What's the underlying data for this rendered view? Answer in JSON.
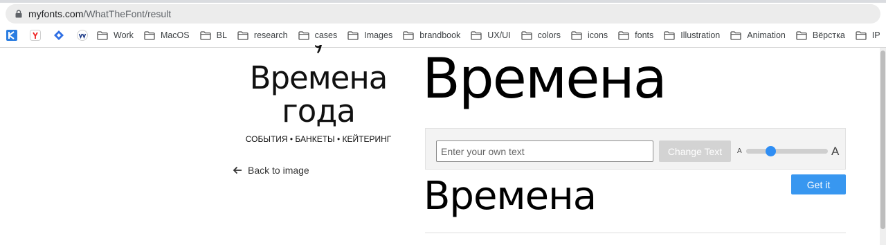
{
  "browser": {
    "url_host": "myfonts.com",
    "url_path": "/WhatTheFont/result",
    "bookmarks": [
      {
        "label": "Work"
      },
      {
        "label": "MacOS"
      },
      {
        "label": "BL"
      },
      {
        "label": "research"
      },
      {
        "label": "cases"
      },
      {
        "label": "Images"
      },
      {
        "label": "brandbook"
      },
      {
        "label": "UX/UI"
      },
      {
        "label": "colors"
      },
      {
        "label": "icons"
      },
      {
        "label": "fonts"
      },
      {
        "label": "Illustration"
      },
      {
        "label": "Animation"
      },
      {
        "label": "Вёрстка"
      },
      {
        "label": "IP"
      }
    ],
    "favicons": [
      "k-app-icon",
      "yandex-icon",
      "diamond-icon",
      "vk-icon"
    ]
  },
  "logo": {
    "line1": "Времена",
    "line2": "года",
    "tagline": "СОБЫТИЯ • БАНКЕТЫ • КЕЙТЕРИНГ"
  },
  "back_link": {
    "label": "Back to image"
  },
  "preview": {
    "main_text": "Времена",
    "secondary_text": "Времена"
  },
  "text_controls": {
    "input_placeholder": "Enter your own text",
    "input_value": "",
    "change_button": "Change Text",
    "size_small_label": "A",
    "size_large_label": "A",
    "size_level": 0.3
  },
  "get_button": {
    "label": "Get it"
  },
  "colors": {
    "accent": "#3897f0",
    "slider_thumb": "#2f8ef4",
    "disabled_button": "#d3d3d3"
  }
}
